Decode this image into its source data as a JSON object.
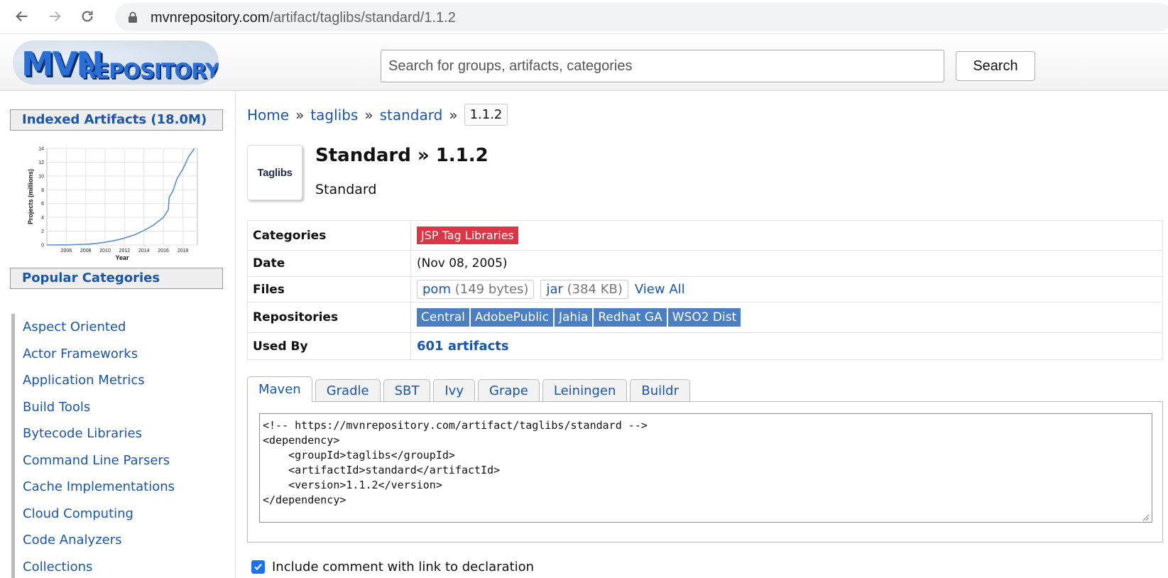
{
  "browser": {
    "url_host": "mvnrepository.com",
    "url_path": "/artifact/taglibs/standard/1.1.2"
  },
  "header": {
    "logo_mvn": "MVN",
    "logo_repository": "REPOSITORY",
    "search_placeholder": "Search for groups, artifacts, categories",
    "search_button": "Search"
  },
  "sidebar": {
    "indexed_title": "Indexed Artifacts (18.0M)",
    "chart_data": {
      "type": "line",
      "title": "",
      "xlabel": "Year",
      "ylabel": "Projects (millions)",
      "x_ticks": [
        "2006",
        "2008",
        "2010",
        "2012",
        "2014",
        "2016",
        "2018"
      ],
      "y_ticks": [
        "0",
        "2",
        "4",
        "6",
        "8",
        "10",
        "12",
        "14"
      ],
      "xlim": [
        2004,
        2019.5
      ],
      "ylim": [
        0,
        14
      ],
      "grid": true,
      "series": [
        {
          "color": "#5b8fc7",
          "x": [
            2004,
            2006,
            2008,
            2009,
            2010,
            2011,
            2012,
            2013,
            2014,
            2015,
            2016,
            2016.5,
            2016.6,
            2017,
            2017.4,
            2018,
            2018.6,
            2019.2
          ],
          "y": [
            0,
            0.02,
            0.1,
            0.2,
            0.4,
            0.65,
            1.0,
            1.45,
            2.1,
            2.9,
            4.0,
            5.1,
            6.9,
            7.9,
            9.6,
            11.0,
            12.8,
            14.0
          ]
        }
      ]
    },
    "popular_title": "Popular Categories",
    "categories": [
      "Aspect Oriented",
      "Actor Frameworks",
      "Application Metrics",
      "Build Tools",
      "Bytecode Libraries",
      "Command Line Parsers",
      "Cache Implementations",
      "Cloud Computing",
      "Code Analyzers",
      "Collections"
    ]
  },
  "breadcrumb": {
    "home": "Home",
    "group": "taglibs",
    "artifact": "standard",
    "sep": "»",
    "version": "1.1.2"
  },
  "artifact": {
    "logo_text": "Taglibs",
    "title": "Standard » 1.1.2",
    "subtitle": "Standard"
  },
  "info": {
    "categories_label": "Categories",
    "category_tag": "JSP Tag Libraries",
    "date_label": "Date",
    "date_value": "(Nov 08, 2005)",
    "files_label": "Files",
    "files": [
      {
        "name": "pom",
        "size": "(149 bytes)"
      },
      {
        "name": "jar",
        "size": "(384 KB)"
      }
    ],
    "view_all": "View All",
    "repositories_label": "Repositories",
    "repositories": [
      "Central",
      "AdobePublic",
      "Jahia",
      "Redhat GA",
      "WSO2 Dist"
    ],
    "used_by_label": "Used By",
    "used_by_value": "601 artifacts"
  },
  "tabs": [
    "Maven",
    "Gradle",
    "SBT",
    "Ivy",
    "Grape",
    "Leiningen",
    "Buildr"
  ],
  "snippet": "<!-- https://mvnrepository.com/artifact/taglibs/standard -->\n<dependency>\n    <groupId>taglibs</groupId>\n    <artifactId>standard</artifactId>\n    <version>1.1.2</version>\n</dependency>",
  "include_comment_label": "Include comment with link to declaration"
}
